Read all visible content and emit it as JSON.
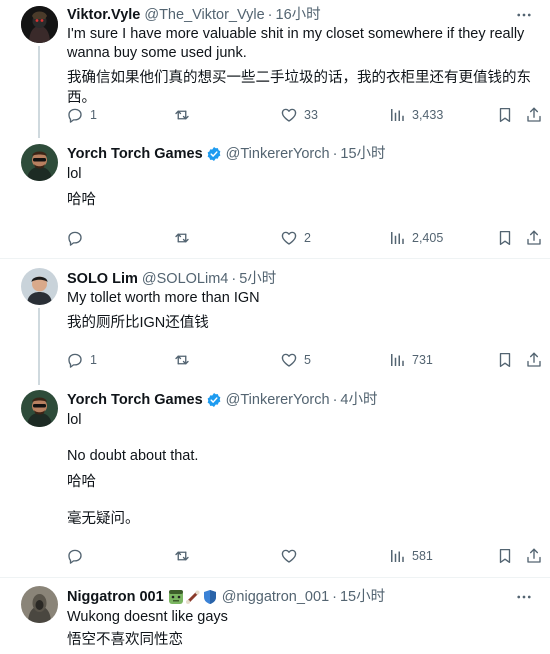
{
  "tweets": [
    {
      "name": "Viktor.Vyle",
      "handle": "@The_Viktor_Vyle",
      "dot": "·",
      "time": "16小时",
      "lines": [
        "I'm sure I have more valuable shit in my closet somewhere if they really",
        "wanna buy some used junk.",
        "我确信如果他们真的想买一些二手垃圾的话，我的衣柜里还有更值钱的东西。"
      ],
      "replies": "1",
      "retweets": "",
      "likes": "33",
      "views": "3,433"
    },
    {
      "name": "Yorch Torch Games",
      "handle": "@TinkererYorch",
      "dot": "·",
      "time": "15小时",
      "lines": [
        "lol",
        "哈哈"
      ],
      "replies": "",
      "retweets": "",
      "likes": "2",
      "views": "2,405"
    },
    {
      "name": "SOLO Lim",
      "handle": "@SOLOLim4",
      "dot": "·",
      "time": "5小时",
      "lines": [
        "My tollet worth more than IGN",
        "我的厕所比IGN还值钱"
      ],
      "replies": "1",
      "retweets": "",
      "likes": "5",
      "views": "731"
    },
    {
      "name": "Yorch Torch Games",
      "handle": "@TinkererYorch",
      "dot": "·",
      "time": "4小时",
      "lines": [
        "lol",
        "No doubt about that.",
        "哈哈",
        "毫无疑问。"
      ],
      "replies": "",
      "retweets": "",
      "likes": "",
      "views": "581"
    },
    {
      "name": "Niggatron 001",
      "handle": "@niggatron_001",
      "dot": "·",
      "time": "15小时",
      "lines": [
        "Wukong doesnt like gays",
        "悟空不喜欢同性恋"
      ]
    }
  ],
  "colors": {
    "text": "#0f1419",
    "secondary": "#536471",
    "verified": "#1d9bf0",
    "divider": "#eff3f4",
    "thread_line": "#cfd9de"
  },
  "icons": [
    "reply-icon",
    "retweet-icon",
    "like-icon",
    "views-icon",
    "bookmark-icon",
    "share-icon",
    "verified-icon",
    "more-icon"
  ]
}
